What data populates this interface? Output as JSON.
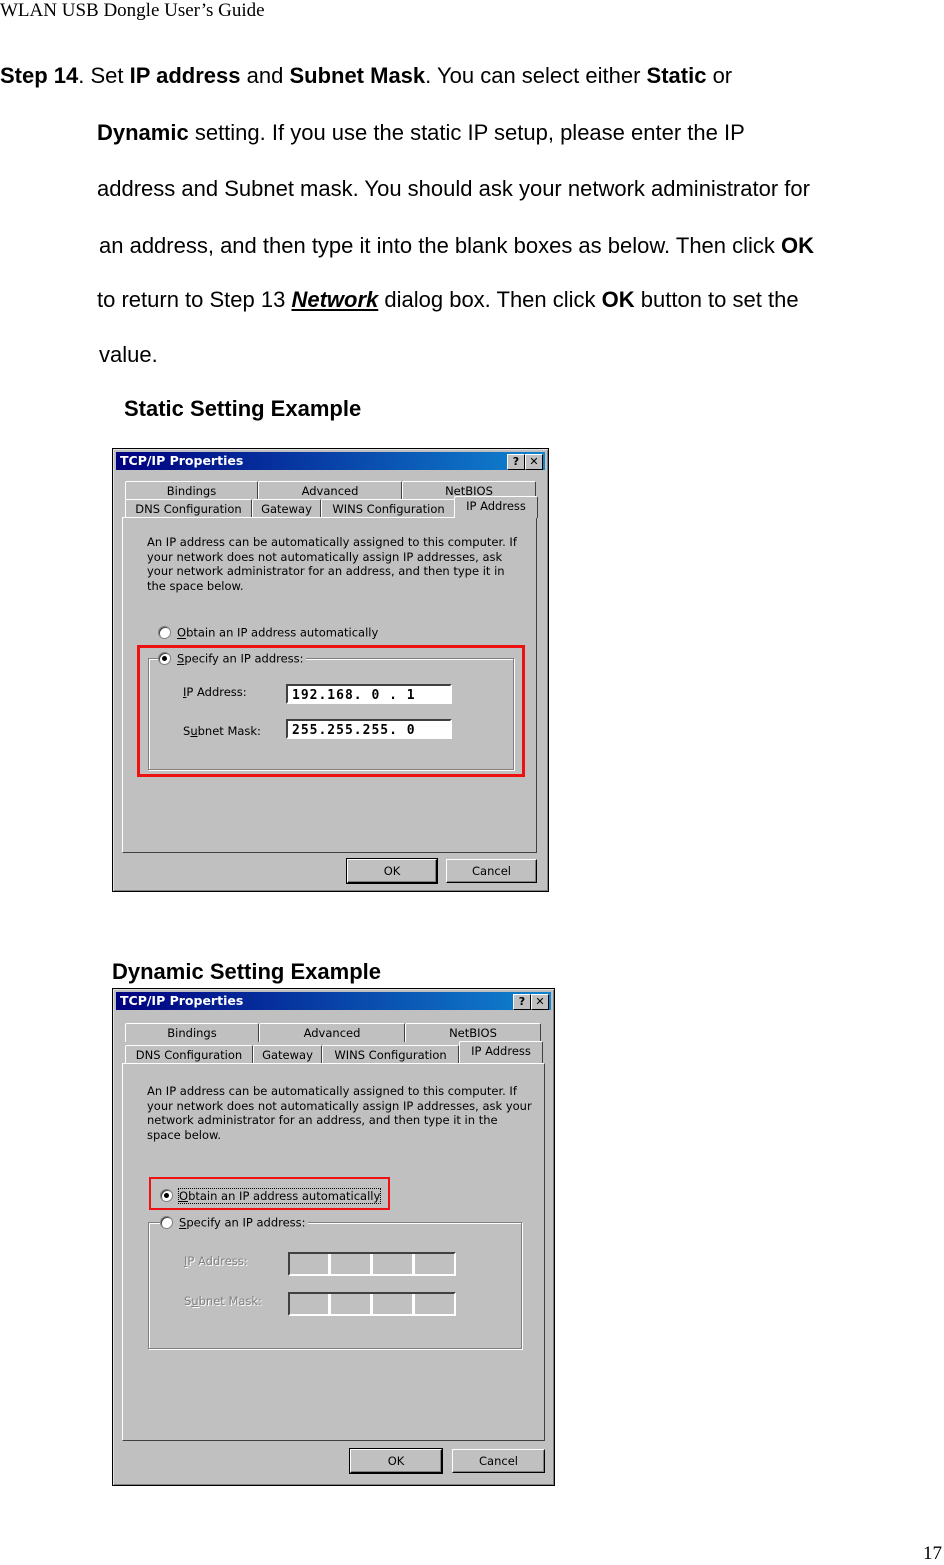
{
  "page": {
    "running_header": "WLAN USB Dongle User’s Guide",
    "page_number": "17"
  },
  "instructions": {
    "l1": {
      "step": "Step 14",
      "t1": ". Set ",
      "b1": "IP address",
      "t2": " and ",
      "b2": "Subnet Mask",
      "t3": ". You can select either ",
      "b3": "Static",
      "t4": " or"
    },
    "l2": {
      "b1": "Dynamic",
      "t1": " setting. If you use the static IP setup, please enter the IP"
    },
    "l3": {
      "t1": "address and Subnet mask. You should ask your network administrator for"
    },
    "l4": {
      "t1": "an address, and then type it into the blank boxes as below. Then click ",
      "b1": "OK"
    },
    "l5": {
      "t1": "to return to Step 13 ",
      "link": "Network",
      "t2": " dialog box. Then click ",
      "b1": "OK",
      "t3": " button to set the"
    },
    "l6": {
      "t1": "value."
    }
  },
  "captions": {
    "static": "Static Setting Example",
    "dynamic": "Dynamic Setting Example"
  },
  "dialogs": {
    "static": {
      "title": "TCP/IP Properties",
      "help_glyph": "?",
      "close_glyph": "✕",
      "tabs_back": [
        "Bindings",
        "Advanced",
        "NetBIOS"
      ],
      "tabs_front": [
        "DNS Configuration",
        "Gateway",
        "WINS Configuration",
        "IP Address"
      ],
      "active_tab": "IP Address",
      "description": "An IP address can be automatically assigned to this computer. If your network does not automatically assign IP addresses, ask your network administrator for an address, and then type it in the space below.",
      "radio_auto": {
        "accel": "O",
        "rest": "btain an IP address automatically",
        "selected": false
      },
      "radio_specify": {
        "accel": "S",
        "rest": "pecify an IP address:",
        "selected": true
      },
      "ip_label": {
        "accel": "I",
        "rest": "P Address:"
      },
      "mask_label": {
        "pre": "S",
        "accel": "u",
        "rest": "bnet Mask:"
      },
      "ip_value": "192.168. 0 . 1",
      "mask_value": "255.255.255. 0",
      "ok": "OK",
      "cancel": "Cancel",
      "highlight_color": "#ee1111"
    },
    "dynamic": {
      "title": "TCP/IP Properties",
      "help_glyph": "?",
      "close_glyph": "✕",
      "tabs_back": [
        "Bindings",
        "Advanced",
        "NetBIOS"
      ],
      "tabs_front": [
        "DNS Configuration",
        "Gateway",
        "WINS Configuration",
        "IP Address"
      ],
      "active_tab": "IP Address",
      "description": "An IP address can be automatically assigned to this computer. If your network does not automatically assign IP addresses, ask your network administrator for an address, and then type it in the space below.",
      "radio_auto": {
        "accel": "O",
        "rest": "btain an IP address automatically",
        "selected": true
      },
      "radio_specify": {
        "accel": "S",
        "rest": "pecify an IP address:",
        "selected": false
      },
      "ip_label": {
        "accel": "I",
        "rest": "P Address:"
      },
      "mask_label": {
        "pre": "S",
        "accel": "u",
        "rest": "bnet Mask:"
      },
      "ip_value": "",
      "mask_value": "",
      "ok": "OK",
      "cancel": "Cancel",
      "highlight_color": "#ee1111"
    }
  }
}
